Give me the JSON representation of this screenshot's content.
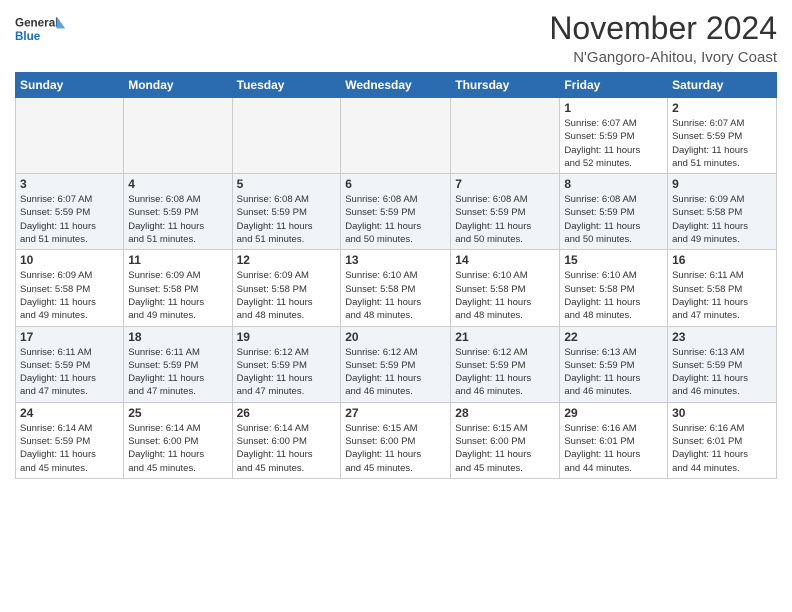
{
  "header": {
    "logo_general": "General",
    "logo_blue": "Blue",
    "month_title": "November 2024",
    "location": "N'Gangoro-Ahitou, Ivory Coast"
  },
  "weekdays": [
    "Sunday",
    "Monday",
    "Tuesday",
    "Wednesday",
    "Thursday",
    "Friday",
    "Saturday"
  ],
  "weeks": [
    [
      {
        "day": "",
        "info": ""
      },
      {
        "day": "",
        "info": ""
      },
      {
        "day": "",
        "info": ""
      },
      {
        "day": "",
        "info": ""
      },
      {
        "day": "",
        "info": ""
      },
      {
        "day": "1",
        "info": "Sunrise: 6:07 AM\nSunset: 5:59 PM\nDaylight: 11 hours\nand 52 minutes."
      },
      {
        "day": "2",
        "info": "Sunrise: 6:07 AM\nSunset: 5:59 PM\nDaylight: 11 hours\nand 51 minutes."
      }
    ],
    [
      {
        "day": "3",
        "info": "Sunrise: 6:07 AM\nSunset: 5:59 PM\nDaylight: 11 hours\nand 51 minutes."
      },
      {
        "day": "4",
        "info": "Sunrise: 6:08 AM\nSunset: 5:59 PM\nDaylight: 11 hours\nand 51 minutes."
      },
      {
        "day": "5",
        "info": "Sunrise: 6:08 AM\nSunset: 5:59 PM\nDaylight: 11 hours\nand 51 minutes."
      },
      {
        "day": "6",
        "info": "Sunrise: 6:08 AM\nSunset: 5:59 PM\nDaylight: 11 hours\nand 50 minutes."
      },
      {
        "day": "7",
        "info": "Sunrise: 6:08 AM\nSunset: 5:59 PM\nDaylight: 11 hours\nand 50 minutes."
      },
      {
        "day": "8",
        "info": "Sunrise: 6:08 AM\nSunset: 5:59 PM\nDaylight: 11 hours\nand 50 minutes."
      },
      {
        "day": "9",
        "info": "Sunrise: 6:09 AM\nSunset: 5:58 PM\nDaylight: 11 hours\nand 49 minutes."
      }
    ],
    [
      {
        "day": "10",
        "info": "Sunrise: 6:09 AM\nSunset: 5:58 PM\nDaylight: 11 hours\nand 49 minutes."
      },
      {
        "day": "11",
        "info": "Sunrise: 6:09 AM\nSunset: 5:58 PM\nDaylight: 11 hours\nand 49 minutes."
      },
      {
        "day": "12",
        "info": "Sunrise: 6:09 AM\nSunset: 5:58 PM\nDaylight: 11 hours\nand 48 minutes."
      },
      {
        "day": "13",
        "info": "Sunrise: 6:10 AM\nSunset: 5:58 PM\nDaylight: 11 hours\nand 48 minutes."
      },
      {
        "day": "14",
        "info": "Sunrise: 6:10 AM\nSunset: 5:58 PM\nDaylight: 11 hours\nand 48 minutes."
      },
      {
        "day": "15",
        "info": "Sunrise: 6:10 AM\nSunset: 5:58 PM\nDaylight: 11 hours\nand 48 minutes."
      },
      {
        "day": "16",
        "info": "Sunrise: 6:11 AM\nSunset: 5:58 PM\nDaylight: 11 hours\nand 47 minutes."
      }
    ],
    [
      {
        "day": "17",
        "info": "Sunrise: 6:11 AM\nSunset: 5:59 PM\nDaylight: 11 hours\nand 47 minutes."
      },
      {
        "day": "18",
        "info": "Sunrise: 6:11 AM\nSunset: 5:59 PM\nDaylight: 11 hours\nand 47 minutes."
      },
      {
        "day": "19",
        "info": "Sunrise: 6:12 AM\nSunset: 5:59 PM\nDaylight: 11 hours\nand 47 minutes."
      },
      {
        "day": "20",
        "info": "Sunrise: 6:12 AM\nSunset: 5:59 PM\nDaylight: 11 hours\nand 46 minutes."
      },
      {
        "day": "21",
        "info": "Sunrise: 6:12 AM\nSunset: 5:59 PM\nDaylight: 11 hours\nand 46 minutes."
      },
      {
        "day": "22",
        "info": "Sunrise: 6:13 AM\nSunset: 5:59 PM\nDaylight: 11 hours\nand 46 minutes."
      },
      {
        "day": "23",
        "info": "Sunrise: 6:13 AM\nSunset: 5:59 PM\nDaylight: 11 hours\nand 46 minutes."
      }
    ],
    [
      {
        "day": "24",
        "info": "Sunrise: 6:14 AM\nSunset: 5:59 PM\nDaylight: 11 hours\nand 45 minutes."
      },
      {
        "day": "25",
        "info": "Sunrise: 6:14 AM\nSunset: 6:00 PM\nDaylight: 11 hours\nand 45 minutes."
      },
      {
        "day": "26",
        "info": "Sunrise: 6:14 AM\nSunset: 6:00 PM\nDaylight: 11 hours\nand 45 minutes."
      },
      {
        "day": "27",
        "info": "Sunrise: 6:15 AM\nSunset: 6:00 PM\nDaylight: 11 hours\nand 45 minutes."
      },
      {
        "day": "28",
        "info": "Sunrise: 6:15 AM\nSunset: 6:00 PM\nDaylight: 11 hours\nand 45 minutes."
      },
      {
        "day": "29",
        "info": "Sunrise: 6:16 AM\nSunset: 6:01 PM\nDaylight: 11 hours\nand 44 minutes."
      },
      {
        "day": "30",
        "info": "Sunrise: 6:16 AM\nSunset: 6:01 PM\nDaylight: 11 hours\nand 44 minutes."
      }
    ]
  ]
}
